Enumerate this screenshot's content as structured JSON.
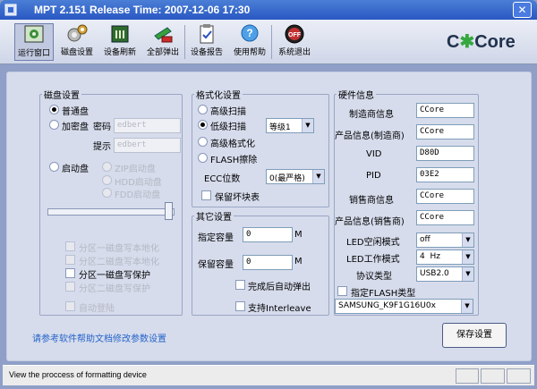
{
  "window": {
    "title": "MPT 2.151 Release Time: 2007-12-06 17:30",
    "close_label": "✕"
  },
  "toolbar": {
    "items": [
      {
        "label": "运行窗口",
        "icon": "run-window-icon"
      },
      {
        "label": "磁盘设置",
        "icon": "disk-settings-icon"
      },
      {
        "label": "设备刷新",
        "icon": "device-refresh-icon"
      },
      {
        "label": "全部弹出",
        "icon": "eject-all-icon"
      },
      {
        "label": "设备报告",
        "icon": "device-report-icon"
      },
      {
        "label": "使用帮助",
        "icon": "help-icon"
      },
      {
        "label": "系统退出",
        "icon": "exit-icon"
      }
    ],
    "logo": "C*Core",
    "logo_c1": "C",
    "logo_star": "✱",
    "logo_rest": "Core"
  },
  "disk_settings": {
    "legend": "磁盘设置",
    "normal_disk": "普通盘",
    "encrypted_disk": "加密盘",
    "password_label": "密码",
    "password_value": "edbert",
    "hint_label": "提示",
    "hint_value": "edbert",
    "boot_disk": "启动盘",
    "zip_boot": "ZIP启动盘",
    "hdd_boot": "HDD启动盘",
    "fdd_boot": "FDD启动盘",
    "partition_options": [
      {
        "label": "分区一磁盘写本地化",
        "enabled": false
      },
      {
        "label": "分区二磁盘写本地化",
        "enabled": false
      },
      {
        "label": "分区一磁盘写保护",
        "enabled": true
      },
      {
        "label": "分区二磁盘写保护",
        "enabled": false
      }
    ],
    "auto_login": "自动登陆",
    "slider_position": 0.95
  },
  "format_settings": {
    "legend": "格式化设置",
    "options": {
      "advanced_scan": "高级扫描",
      "low_scan": "低级扫描",
      "advanced_format": "高级格式化",
      "flash_erase": "FLASH擦除"
    },
    "low_scan_level": "等级1",
    "ecc_label": "ECC位数",
    "ecc_value": "0(最严格)",
    "keep_bad_blocks": "保留坏块表"
  },
  "other_settings": {
    "legend": "其它设置",
    "capacity_label": "指定容量",
    "capacity_value": "0",
    "capacity_unit": "M",
    "reserve_label": "保留容量",
    "reserve_value": "0",
    "reserve_unit": "M",
    "auto_eject": "完成后自动弹出",
    "interleave": "支持Interleave"
  },
  "hardware_info": {
    "legend": "硬件信息",
    "fields": [
      {
        "label": "制造商信息",
        "value": "CCore"
      },
      {
        "label": "产品信息(制造商)",
        "value": "CCore"
      },
      {
        "label": "VID",
        "value": "D80D"
      },
      {
        "label": "PID",
        "value": "03E2"
      },
      {
        "label": "销售商信息",
        "value": "CCore"
      },
      {
        "label": "产品信息(销售商)",
        "value": "CCore"
      }
    ],
    "led_idle_label": "LED空闲模式",
    "led_idle_value": "off",
    "led_work_label": "LED工作模式",
    "led_work_value": "4  Hz",
    "protocol_label": "协议类型",
    "protocol_value": "USB2.0",
    "flash_type_label": "指定FLASH类型",
    "flash_type_value": "SAMSUNG_K9F1G16U0x"
  },
  "footer": {
    "help_link": "请参考软件帮助文档修改参数设置",
    "save_button": "保存设置"
  },
  "status": {
    "text": "View the proccess of formatting device"
  }
}
